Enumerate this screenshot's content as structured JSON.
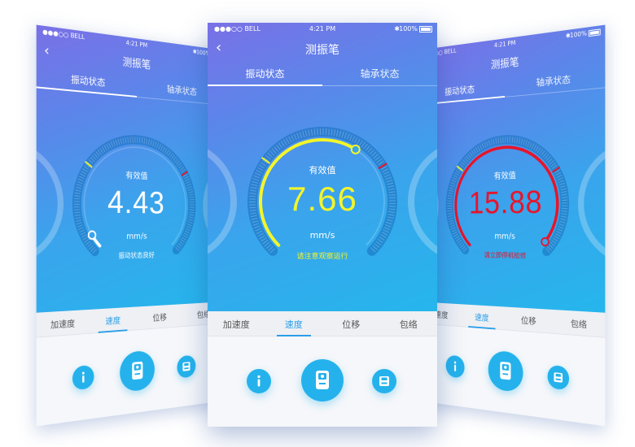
{
  "status": {
    "carrier": "●●●○○ BELL",
    "time": "4:21 PM",
    "battery": "100%"
  },
  "app": {
    "title": "测振笔",
    "back_icon": "chevron-left-icon"
  },
  "tabs": [
    "振动状态",
    "轴承状态"
  ],
  "gauge_label": "有效值",
  "unit": "mm/s",
  "bottom_tabs": [
    "加速度",
    "速度",
    "位移",
    "包络"
  ],
  "active_bottom_tab": 1,
  "icons": {
    "info": "info-icon",
    "device": "device-icon",
    "save": "save-icon"
  },
  "phones": {
    "left": {
      "value": "4.43",
      "status": "振动状态良好",
      "value_color": "#ffffff",
      "status_color": "#ffffff",
      "level": 0.05
    },
    "center": {
      "value": "7.66",
      "status": "请注意观察运行",
      "value_color": "#f3f52b",
      "status_color": "#f3f52b",
      "level": 0.62
    },
    "right": {
      "value": "15.88",
      "status": "请立即停机检修",
      "value_color": "#e8142a",
      "status_color": "#e8142a",
      "level": 0.98
    }
  }
}
